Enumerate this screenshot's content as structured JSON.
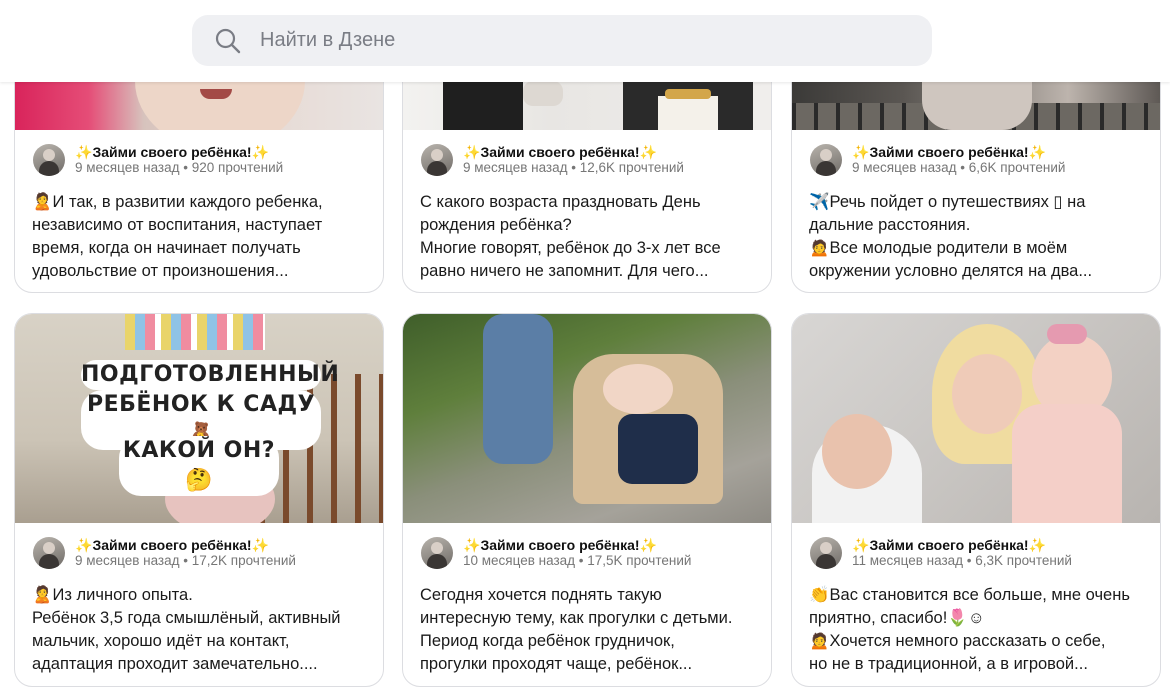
{
  "search": {
    "placeholder": "Найти в Дзене"
  },
  "channel_name": "Займи своего ребёнка!",
  "cards": [
    {
      "stats": "9 месяцев назад • 920 прочтений",
      "lines": [
        "🙎И так, в развитии каждого ребенка,",
        "независимо от воспитания, наступает",
        "время, когда он начинает получать",
        "удовольствие от произношения..."
      ]
    },
    {
      "stats": "9 месяцев назад • 12,6K прочтений",
      "lines": [
        "С какого возраста праздновать День",
        "рождения ребёнка?",
        "Многие говорят, ребёнок до 3-х лет все",
        "равно ничего не запомнит. Для чего..."
      ]
    },
    {
      "stats": "9 месяцев назад • 6,6K прочтений",
      "lines": [
        "✈️Речь пойдет о путешествиях ▯ на",
        "дальние расстояния.",
        "🙍Все молодые родители в моём",
        "окружении условно делятся на два..."
      ]
    },
    {
      "stats": "9 месяцев назад • 17,2K прочтений",
      "overlay": [
        "ПОДГОТОВЛЕННЫЙ",
        "РЕБЁНОК К САДУ 🧸",
        "КАКОЙ ОН?🤔"
      ],
      "lines": [
        "🙎Из личного опыта.",
        "Ребёнок 3,5 года смышлёный, активный",
        "мальчик, хорошо идёт на контакт,",
        "адаптация проходит замечательно...."
      ]
    },
    {
      "stats": "10 месяцев назад • 17,5K прочтений",
      "lines": [
        "Сегодня хочется поднять такую",
        "интересную тему, как прогулки с детьми.",
        "Период когда ребёнок грудничок,",
        "прогулки проходят чаще, ребёнок..."
      ]
    },
    {
      "stats": "11 месяцев назад • 6,3K прочтений",
      "lines": [
        "👏Вас становится все больше, мне очень",
        "приятно, спасибо!🌷☺",
        "🙍Хочется немного рассказать о себе,",
        "но не в традиционной, а в игровой..."
      ]
    }
  ]
}
